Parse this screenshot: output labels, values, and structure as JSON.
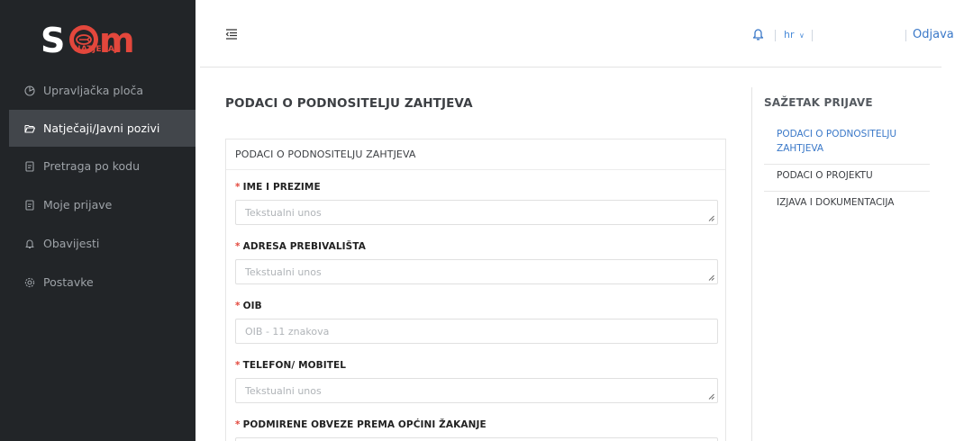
{
  "brand": {
    "logo_text": "SOM",
    "logo_subtitle": "NATJEČAJI",
    "accent_color": "#e3473c"
  },
  "sidebar": {
    "items": [
      {
        "label": "Upravljačka ploča",
        "icon": "dashboard-icon"
      },
      {
        "label": "Natječaji/Javni pozivi",
        "icon": "folder-open-icon",
        "active": true
      },
      {
        "label": "Pretraga po kodu",
        "icon": "document-icon"
      },
      {
        "label": "Moje prijave",
        "icon": "document-icon"
      },
      {
        "label": "Obavijesti",
        "icon": "bell-icon"
      },
      {
        "label": "Postavke",
        "icon": "gear-icon"
      }
    ]
  },
  "topbar": {
    "menu_icon": "menu-collapse-icon",
    "notification_icon": "bell-icon",
    "language": "hr",
    "logout_label": "Odjava"
  },
  "main": {
    "page_title": "PODACI O PODNOSITELJU ZAHTJEVA",
    "card_title": "PODACI O PODNOSITELJU ZAHTJEVA",
    "fields": [
      {
        "label": "IME I PREZIME",
        "placeholder": "Tekstualni unos",
        "required": true,
        "type": "textarea"
      },
      {
        "label": "ADRESA PREBIVALIŠTA",
        "placeholder": "Tekstualni unos",
        "required": true,
        "type": "textarea"
      },
      {
        "label": "OIB",
        "placeholder": "OIB - 11 znakova",
        "required": true,
        "type": "input"
      },
      {
        "label": "TELEFON/ MOBITEL",
        "placeholder": "Tekstualni unos",
        "required": true,
        "type": "textarea"
      },
      {
        "label": "PODMIRENE OBVEZE PREMA OPĆINI ŽAKANJE",
        "placeholder": "",
        "required": true,
        "type": "input"
      }
    ]
  },
  "summary": {
    "title": "SAŽETAK PRIJAVE",
    "items": [
      {
        "label": "PODACI O PODNOSITELJU ZAHTJEVA",
        "active": true
      },
      {
        "label": "PODACI O PROJEKTU",
        "active": false
      },
      {
        "label": "IZJAVA I DOKUMENTACIJA",
        "active": false
      }
    ]
  }
}
